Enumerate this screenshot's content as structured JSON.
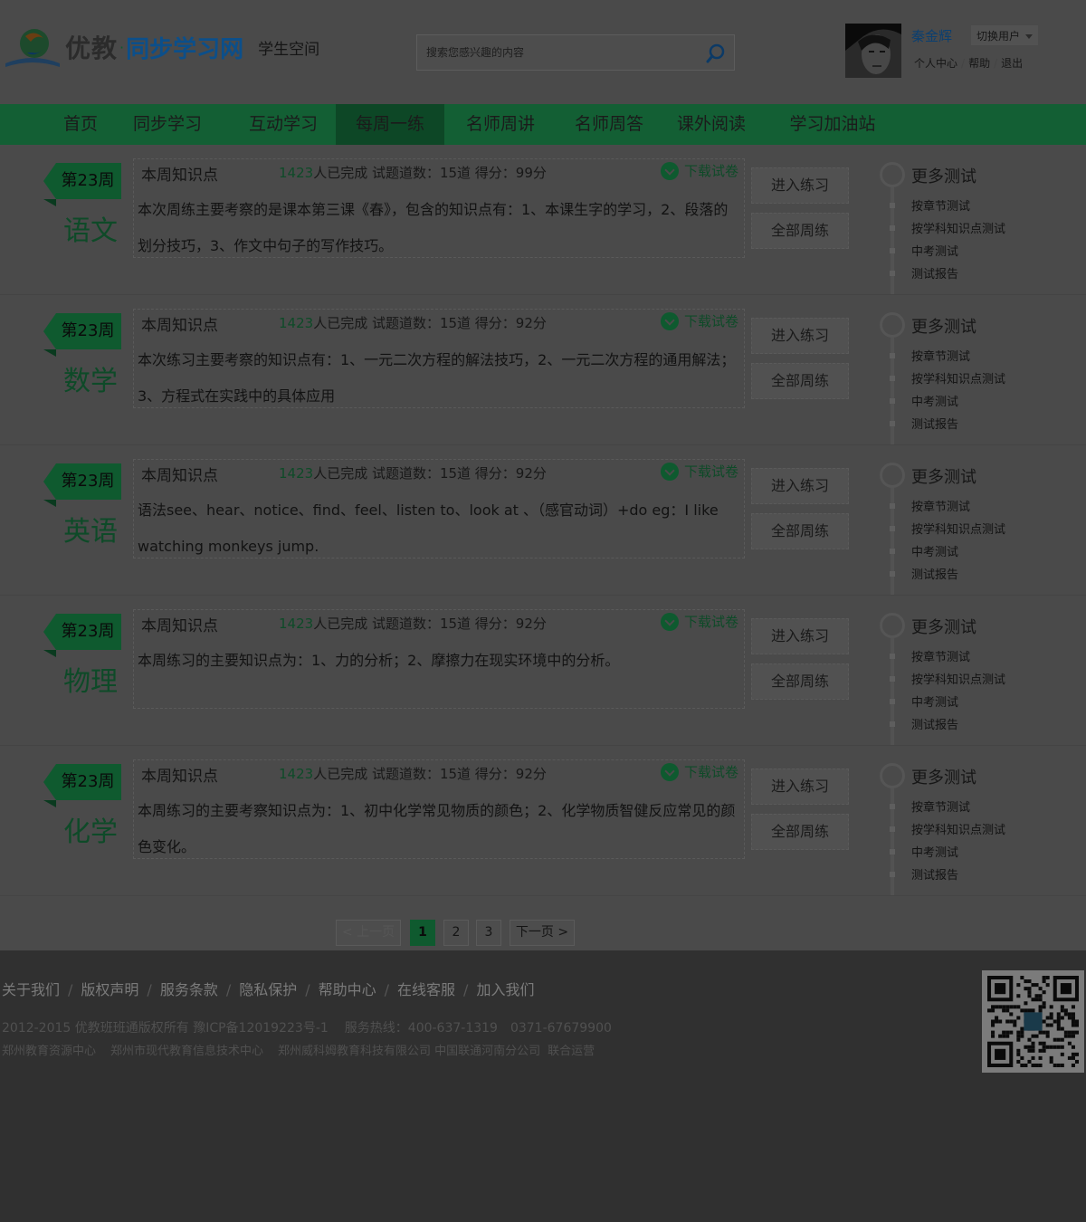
{
  "header": {
    "brand": "优教",
    "brand_sub": "同步学习网",
    "space": "学生空间",
    "search_placeholder": "搜索您感兴趣的内容",
    "user_name": "秦金辉",
    "switch_user": "切换用户",
    "links": [
      "个人中心",
      "帮助",
      "退出"
    ]
  },
  "nav": {
    "items": [
      "首页",
      "同步学习",
      "互动学习",
      "每周一练",
      "名师周讲",
      "名师周答",
      "课外阅读",
      "学习加油站"
    ],
    "active": "每周一练"
  },
  "rows": [
    {
      "week": "第23周",
      "subject": "语文",
      "tab": "本周知识点",
      "completed": "1423",
      "stats_text": "人已完成 试题道数：15道 得分：99分",
      "download": "下载试卷",
      "desc": "本次周练主要考察的是课本第三课《春》，包含的知识点有：1、本课生字的学习，2、段落的划分技巧，3、作文中句子的写作技巧。",
      "btn_practice": "进入练习",
      "btn_all": "全部周练",
      "more_title": "更多测试",
      "more_links": [
        "按章节测试",
        "按学科知识点测试",
        "中考测试",
        "测试报告"
      ]
    },
    {
      "week": "第23周",
      "subject": "数学",
      "tab": "本周知识点",
      "completed": "1423",
      "stats_text": "人已完成 试题道数：15道 得分：92分",
      "download": "下载试卷",
      "desc": "本次练习主要考察的知识点有：1、一元二次方程的解法技巧，2、一元二次方程的通用解法；3、方程式在实践中的具体应用",
      "btn_practice": "进入练习",
      "btn_all": "全部周练",
      "more_title": "更多测试",
      "more_links": [
        "按章节测试",
        "按学科知识点测试",
        "中考测试",
        "测试报告"
      ]
    },
    {
      "week": "第23周",
      "subject": "英语",
      "tab": "本周知识点",
      "completed": "1423",
      "stats_text": "人已完成 试题道数：15道 得分：92分",
      "download": "下载试卷",
      "desc": "语法see、hear、notice、find、feel、listen to、look at 、（感官动词）+do eg：I like watching monkeys jump.",
      "btn_practice": "进入练习",
      "btn_all": "全部周练",
      "more_title": "更多测试",
      "more_links": [
        "按章节测试",
        "按学科知识点测试",
        "中考测试",
        "测试报告"
      ]
    },
    {
      "week": "第23周",
      "subject": "物理",
      "tab": "本周知识点",
      "completed": "1423",
      "stats_text": "人已完成 试题道数：15道 得分：92分",
      "download": "下载试卷",
      "desc": "本周练习的主要知识点为：1、力的分析；2、摩擦力在现实环境中的分析。",
      "btn_practice": "进入练习",
      "btn_all": "全部周练",
      "more_title": "更多测试",
      "more_links": [
        "按章节测试",
        "按学科知识点测试",
        "中考测试",
        "测试报告"
      ]
    },
    {
      "week": "第23周",
      "subject": "化学",
      "tab": "本周知识点",
      "completed": "1423",
      "stats_text": "人已完成 试题道数：15道 得分：92分",
      "download": "下载试卷",
      "desc": "本周练习的主要考察知识点为：1、初中化学常见物质的颜色；2、化学物质智健反应常见的颜色变化。",
      "btn_practice": "进入练习",
      "btn_all": "全部周练",
      "more_title": "更多测试",
      "more_links": [
        "按章节测试",
        "按学科知识点测试",
        "中考测试",
        "测试报告"
      ]
    }
  ],
  "pagination": {
    "prev": "< 上一页",
    "pages": [
      "1",
      "2",
      "3"
    ],
    "current": "1",
    "next": "下一页 >"
  },
  "footer": {
    "links": [
      "关于我们",
      "版权声明",
      "服务条款",
      "隐私保护",
      "帮助中心",
      "在线客服",
      "加入我们"
    ],
    "copyright": "2012-2015 优教班班通版权所有 豫ICP备12019223号-1",
    "hotline": "服务热线：400-637-1319　0371-67679900",
    "operators": [
      "郑州教育资源中心",
      "郑州市现代教育信息技术中心",
      "郑州威科姆教育科技有限公司 中国联通河南分公司",
      "联合运营"
    ]
  },
  "colors": {
    "nav_bg": "#135f34",
    "nav_active": "#0d4726",
    "accent_green": "#0e4a28",
    "footer_bg": "#303030",
    "overlay_bg": "#4a4a4a"
  }
}
